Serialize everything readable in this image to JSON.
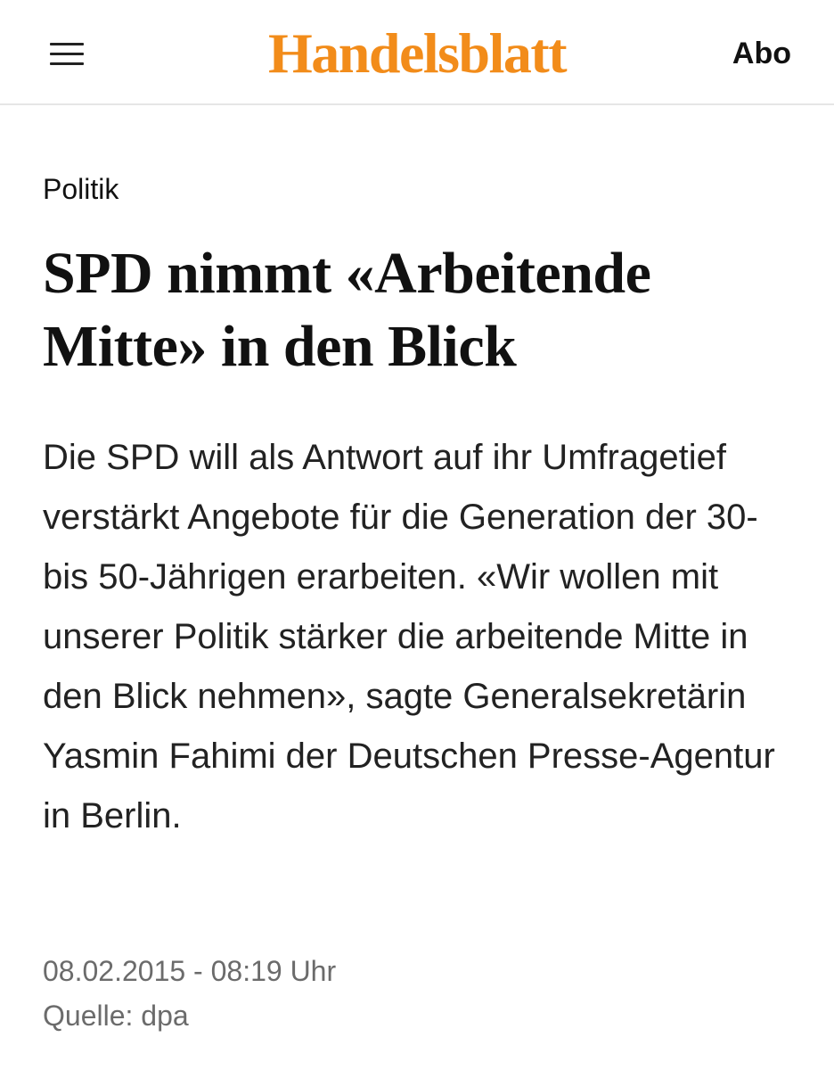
{
  "header": {
    "menu_icon": "hamburger-menu-icon",
    "logo_text": "Handelsblatt",
    "abo_label": "Abo",
    "brand_color": "#f28c1a"
  },
  "article": {
    "category": "Politik",
    "headline": "SPD nimmt «Arbeitende Mitte» in den Blick",
    "lead": "Die SPD will als Antwort auf ihr Umfragetief verstärkt Angebote für die Generation der 30- bis 50-Jährigen erarbeiten. «Wir wollen mit unserer Politik stärker die arbeitende Mitte in den Blick nehmen», sagte Generalsekretärin Yasmin Fahimi der Deutschen Presse-Agentur in Berlin.",
    "timestamp": "08.02.2015 - 08:19 Uhr",
    "source": "Quelle: dpa"
  }
}
